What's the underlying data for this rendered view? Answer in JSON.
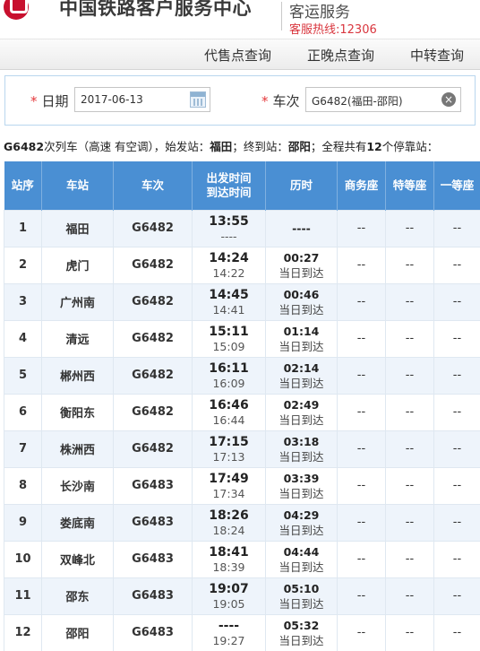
{
  "header": {
    "brand": "中国铁路客户服务中心",
    "subtitle": "客运服务",
    "hotline": "客服热线:12306"
  },
  "nav": [
    "代售点查询",
    "正晚点查询",
    "中转查询"
  ],
  "query": {
    "date_label": "日期",
    "date_value": "2017-06-13",
    "train_label": "车次",
    "train_value": "G6482(福田-邵阳)"
  },
  "summary": {
    "train": "G6482",
    "text1": "次列车（高速 有空调），始发站：",
    "origin": "福田",
    "text2": "；终到站：",
    "terminal": "邵阳",
    "text3": "；全程共有",
    "count": "12",
    "text4": "个停靠站："
  },
  "table": {
    "headers": {
      "no": "站序",
      "station": "车站",
      "train": "车次",
      "time_dep": "出发时间",
      "time_arr": "到达时间",
      "duration": "历时",
      "business": "商务座",
      "special": "特等座",
      "first": "一等座"
    },
    "rows": [
      {
        "no": "1",
        "station": "福田",
        "train": "G6482",
        "dep": "13:55",
        "arr": "----",
        "dur": "----",
        "note": "",
        "business": "--",
        "special": "--",
        "first": "--"
      },
      {
        "no": "2",
        "station": "虎门",
        "train": "G6482",
        "dep": "14:24",
        "arr": "14:22",
        "dur": "00:27",
        "note": "当日到达",
        "business": "--",
        "special": "--",
        "first": "--"
      },
      {
        "no": "3",
        "station": "广州南",
        "train": "G6482",
        "dep": "14:45",
        "arr": "14:41",
        "dur": "00:46",
        "note": "当日到达",
        "business": "--",
        "special": "--",
        "first": "--"
      },
      {
        "no": "4",
        "station": "清远",
        "train": "G6482",
        "dep": "15:11",
        "arr": "15:09",
        "dur": "01:14",
        "note": "当日到达",
        "business": "--",
        "special": "--",
        "first": "--"
      },
      {
        "no": "5",
        "station": "郴州西",
        "train": "G6482",
        "dep": "16:11",
        "arr": "16:09",
        "dur": "02:14",
        "note": "当日到达",
        "business": "--",
        "special": "--",
        "first": "--"
      },
      {
        "no": "6",
        "station": "衡阳东",
        "train": "G6482",
        "dep": "16:46",
        "arr": "16:44",
        "dur": "02:49",
        "note": "当日到达",
        "business": "--",
        "special": "--",
        "first": "--"
      },
      {
        "no": "7",
        "station": "株洲西",
        "train": "G6482",
        "dep": "17:15",
        "arr": "17:13",
        "dur": "03:18",
        "note": "当日到达",
        "business": "--",
        "special": "--",
        "first": "--"
      },
      {
        "no": "8",
        "station": "长沙南",
        "train": "G6483",
        "dep": "17:49",
        "arr": "17:34",
        "dur": "03:39",
        "note": "当日到达",
        "business": "--",
        "special": "--",
        "first": "--"
      },
      {
        "no": "9",
        "station": "娄底南",
        "train": "G6483",
        "dep": "18:26",
        "arr": "18:24",
        "dur": "04:29",
        "note": "当日到达",
        "business": "--",
        "special": "--",
        "first": "--"
      },
      {
        "no": "10",
        "station": "双峰北",
        "train": "G6483",
        "dep": "18:41",
        "arr": "18:39",
        "dur": "04:44",
        "note": "当日到达",
        "business": "--",
        "special": "--",
        "first": "--"
      },
      {
        "no": "11",
        "station": "邵东",
        "train": "G6483",
        "dep": "19:07",
        "arr": "19:05",
        "dur": "05:10",
        "note": "当日到达",
        "business": "--",
        "special": "--",
        "first": "--"
      },
      {
        "no": "12",
        "station": "邵阳",
        "train": "G6483",
        "dep": "----",
        "arr": "19:27",
        "dur": "05:32",
        "note": "当日到达",
        "business": "--",
        "special": "--",
        "first": "--"
      }
    ]
  },
  "colors": {
    "header_blue": "#4a8fd3",
    "row_alt": "#eef4fb",
    "logo_red": "#c8102e",
    "hotline_red": "#d9363e"
  }
}
